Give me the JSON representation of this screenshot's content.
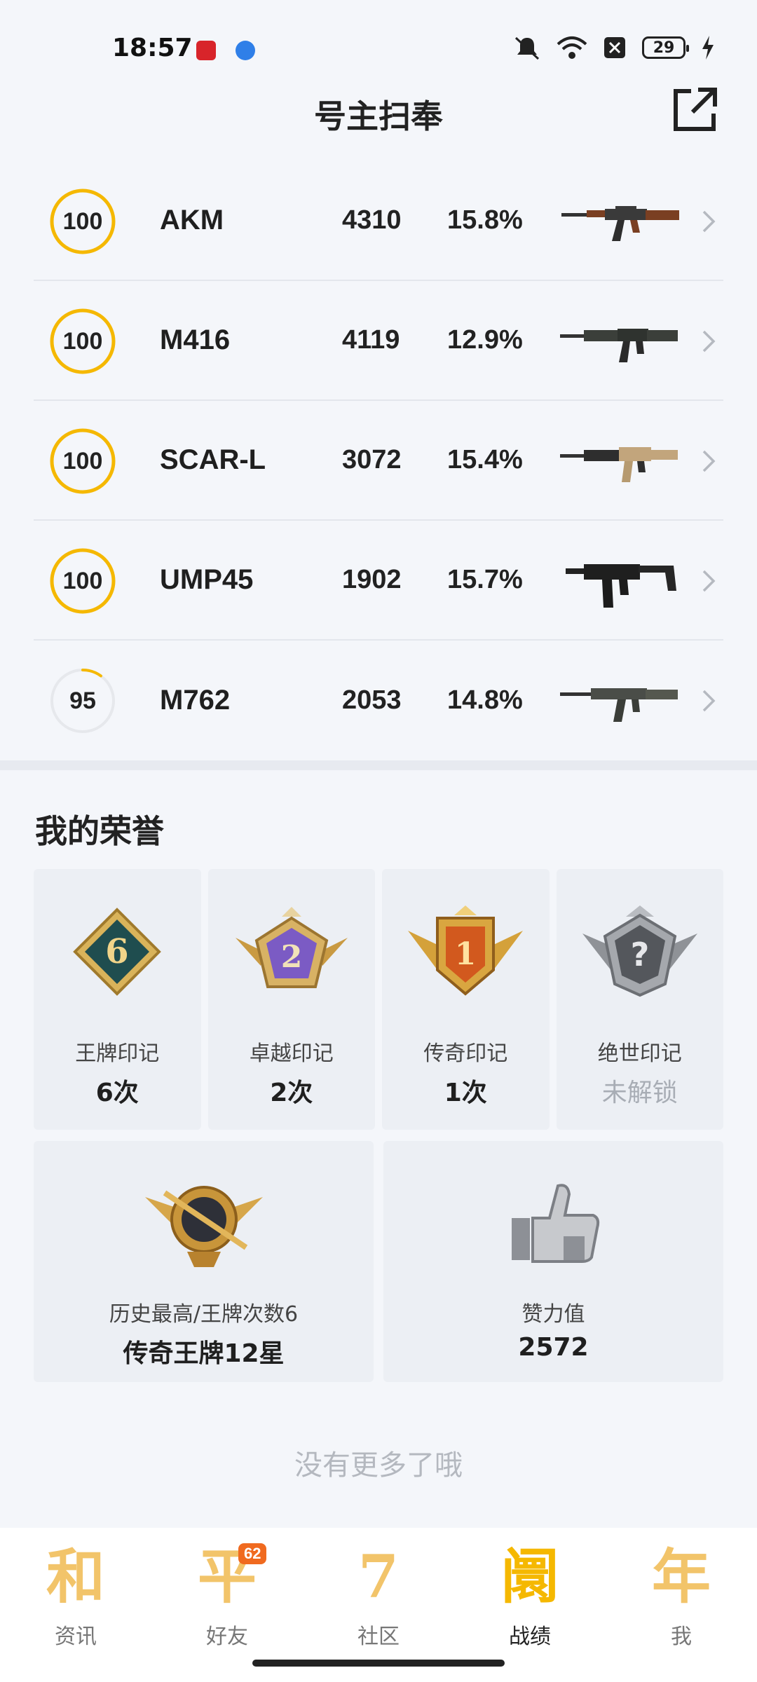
{
  "status": {
    "time": "18:57",
    "battery": "29"
  },
  "header": {
    "title": "号主扫奉"
  },
  "weapons": [
    {
      "score": "100",
      "score_fraction": 1.0,
      "name": "AKM",
      "count": "4310",
      "rate": "15.8%"
    },
    {
      "score": "100",
      "score_fraction": 1.0,
      "name": "M416",
      "count": "4119",
      "rate": "12.9%"
    },
    {
      "score": "100",
      "score_fraction": 1.0,
      "name": "SCAR-L",
      "count": "3072",
      "rate": "15.4%"
    },
    {
      "score": "100",
      "score_fraction": 1.0,
      "name": "UMP45",
      "count": "1902",
      "rate": "15.7%"
    },
    {
      "score": "95",
      "score_fraction": 0.1,
      "name": "M762",
      "count": "2053",
      "rate": "14.8%"
    }
  ],
  "honors": {
    "title": "我的荣誉",
    "badges": [
      {
        "label": "王牌印记",
        "value": "6次",
        "number": "6",
        "locked": false
      },
      {
        "label": "卓越印记",
        "value": "2次",
        "number": "2",
        "locked": false
      },
      {
        "label": "传奇印记",
        "value": "1次",
        "number": "1",
        "locked": false
      },
      {
        "label": "绝世印记",
        "value": "未解锁",
        "number": "?",
        "locked": true
      }
    ],
    "stats": [
      {
        "label": "历史最高/王牌次数6",
        "value": "传奇王牌12星"
      },
      {
        "label": "赞力值",
        "value": "2572"
      }
    ]
  },
  "end_text": "没有更多了哦",
  "nav": {
    "items": [
      {
        "glyph": "和",
        "label": "资讯",
        "active": false
      },
      {
        "glyph": "平",
        "label": "好友",
        "active": false,
        "badge": "62"
      },
      {
        "glyph": "7",
        "label": "社区",
        "active": false
      },
      {
        "glyph": "阛",
        "label": "战绩",
        "active": true
      },
      {
        "glyph": "年",
        "label": "我",
        "active": false
      }
    ]
  },
  "colors": {
    "ring_gold": "#f5b800",
    "ring_track": "#e6e8ec",
    "background": "#f4f6fa"
  }
}
